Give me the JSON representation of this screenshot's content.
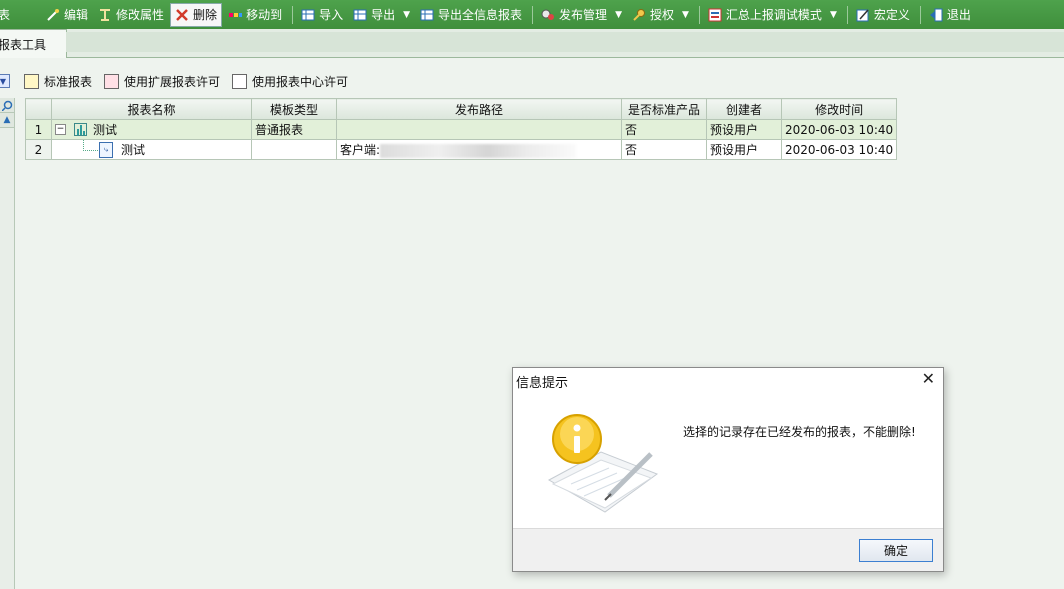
{
  "toolbar": {
    "items": [
      {
        "label": "表",
        "icon": "report-icon"
      },
      {
        "label": "编辑",
        "icon": "edit-icon"
      },
      {
        "label": "修改属性",
        "icon": "properties-icon"
      },
      {
        "label": "删除",
        "icon": "delete-icon"
      },
      {
        "label": "移动到",
        "icon": "move-icon"
      },
      {
        "label": "导入",
        "icon": "import-icon"
      },
      {
        "label": "导出",
        "icon": "export-icon"
      },
      {
        "label": "导出全信息报表",
        "icon": "export-full-icon"
      },
      {
        "label": "发布管理",
        "icon": "publish-icon"
      },
      {
        "label": "授权",
        "icon": "key-icon"
      },
      {
        "label": "汇总上报调试模式",
        "icon": "debug-icon"
      },
      {
        "label": "宏定义",
        "icon": "macro-icon"
      },
      {
        "label": "退出",
        "icon": "exit-icon"
      }
    ]
  },
  "tab": {
    "label": "报表工具"
  },
  "legend": [
    {
      "label": "标准报表",
      "color": "#fff7c6"
    },
    {
      "label": "使用扩展报表许可",
      "color": "#ffe0e6"
    },
    {
      "label": "使用报表中心许可",
      "color": "#ffffff"
    }
  ],
  "grid": {
    "headers": [
      "报表名称",
      "模板类型",
      "发布路径",
      "是否标准产品",
      "创建者",
      "修改时间"
    ],
    "rows": [
      {
        "index": "1",
        "name": "测试",
        "type": "普通报表",
        "path": "",
        "standard": "否",
        "creator": "预设用户",
        "modified": "2020-06-03 10:40"
      },
      {
        "index": "2",
        "name": "测试",
        "type": "",
        "path": "客户端:",
        "standard": "否",
        "creator": "预设用户",
        "modified": "2020-06-03 10:40"
      }
    ]
  },
  "dialog": {
    "title": "信息提示",
    "message": "选择的记录存在已经发布的报表，不能删除!",
    "ok_label": "确定",
    "icon": "info-icon"
  },
  "colors": {
    "toolbar": "#4ea24c",
    "selected_row": "#e2f0d9",
    "dialog_button_border": "#3c7fd1"
  }
}
